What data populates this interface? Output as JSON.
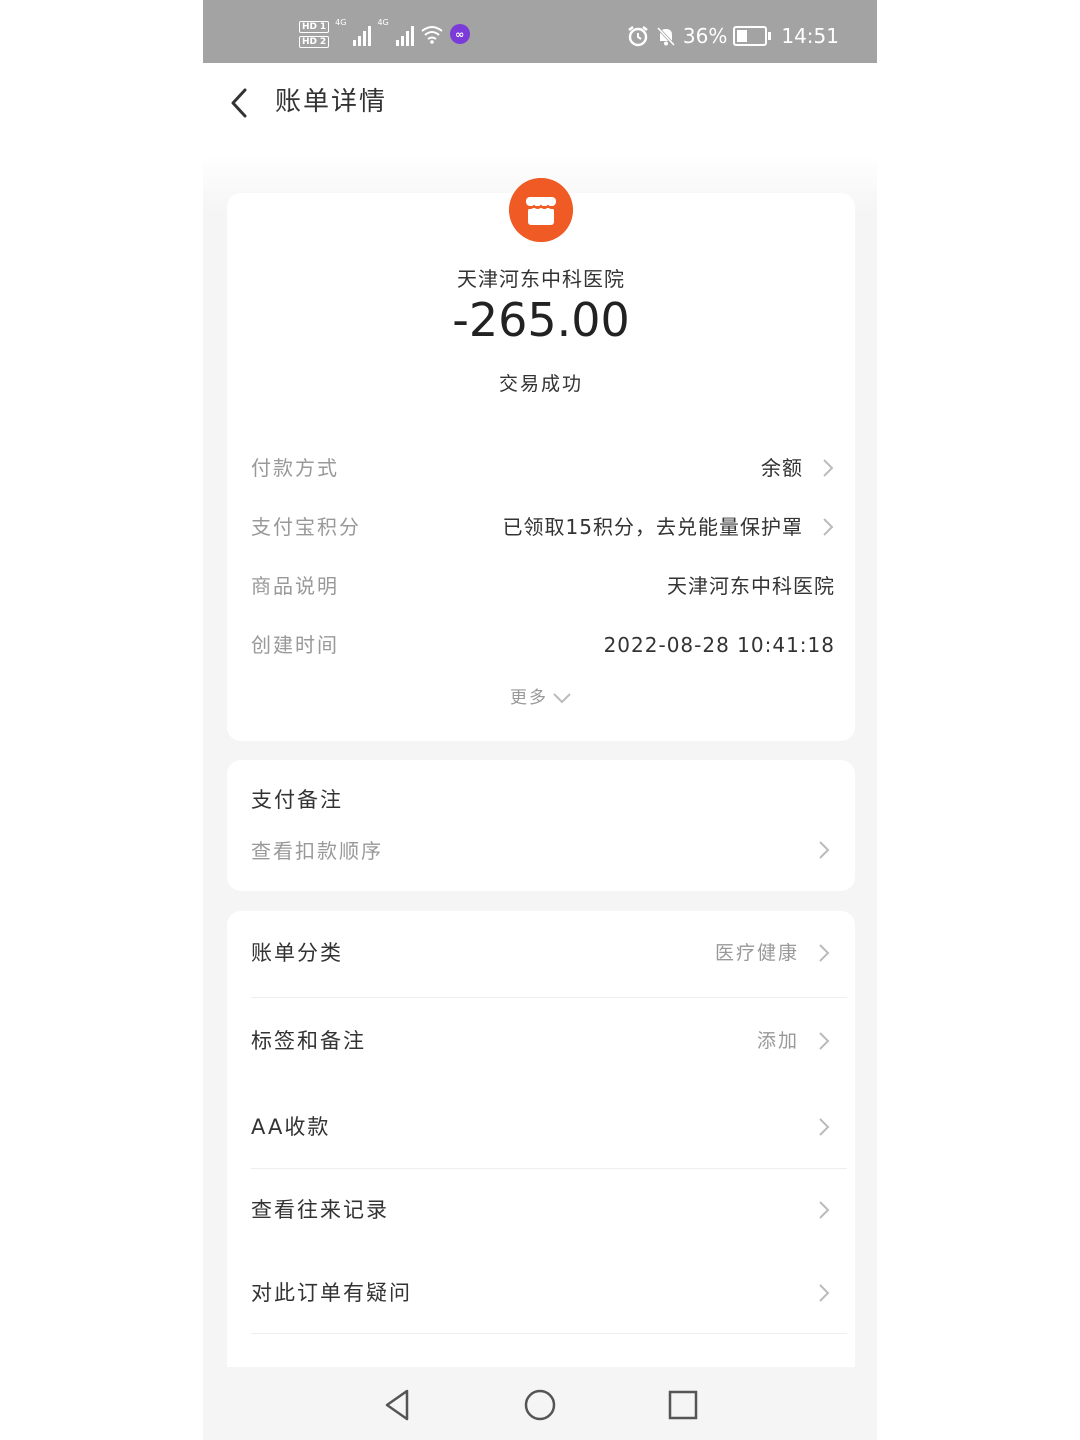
{
  "status_bar": {
    "hd1": "HD",
    "sim1": "1",
    "hd2": "HD",
    "sim2": "2",
    "net1": "4G",
    "net2": "4G",
    "battery": "36%",
    "battery_level": 0.36,
    "time": "14:51",
    "icons": [
      "alarm-icon",
      "mute-bell-icon",
      "wifi-icon",
      "hotspot-icon"
    ]
  },
  "header": {
    "title": "账单详情",
    "back_icon": "back-arrow-icon"
  },
  "bill": {
    "merchant_icon": "store-icon",
    "merchant": "天津河东中科医院",
    "amount": "-265.00",
    "status": "交易成功",
    "details": [
      {
        "label": "付款方式",
        "value": "余额"
      },
      {
        "label": "支付宝积分",
        "value": "已领取15积分，去兑能量保护罩"
      },
      {
        "label": "商品说明",
        "value": "天津河东中科医院"
      },
      {
        "label": "创建时间",
        "value": "2022-08-28 10:41:18"
      }
    ],
    "more": "更多"
  },
  "note": {
    "title": "支付备注",
    "link": "查看扣款顺序"
  },
  "actions": [
    {
      "label": "账单分类",
      "value": "医疗健康"
    },
    {
      "label": "标签和备注",
      "value": "添加"
    },
    {
      "label": "AA收款",
      "value": ""
    },
    {
      "label": "查看往来记录",
      "value": ""
    },
    {
      "label": "对此订单有疑问",
      "value": ""
    }
  ],
  "colors": {
    "accent": "#f05a24",
    "status_bar": "#a3a3a3",
    "page_bg": "#f5f5f5"
  },
  "nav": {
    "icons": [
      "back-triangle-icon",
      "home-circle-icon",
      "recents-square-icon"
    ]
  }
}
